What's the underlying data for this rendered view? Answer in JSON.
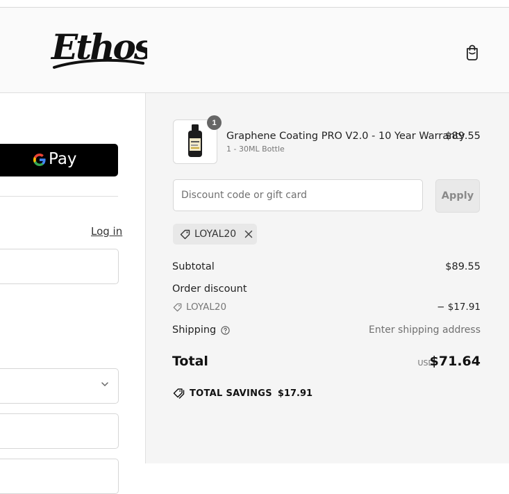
{
  "brand": {
    "logo_text": "Ethos"
  },
  "header": {
    "cart_icon": "shopping-bag-icon"
  },
  "express_checkout": {
    "gpay_label": "Pay",
    "gpay_g": "G"
  },
  "contact": {
    "login_label": "Log in"
  },
  "cart": {
    "items": [
      {
        "name": "Graphene Coating PRO V2.0 - 10 Year Warranty",
        "variant": "1 - 30ML Bottle",
        "price": "$89.55",
        "quantity": "1"
      }
    ]
  },
  "discount": {
    "placeholder": "Discount code or gift card",
    "apply_label": "Apply",
    "applied_code": "LOYAL20"
  },
  "summary": {
    "subtotal_label": "Subtotal",
    "subtotal_value": "$89.55",
    "order_discount_label": "Order discount",
    "discount_code": "LOYAL20",
    "discount_value": "− $17.91",
    "shipping_label": "Shipping",
    "shipping_value": "Enter shipping address",
    "total_label": "Total",
    "currency": "USD",
    "total_value": "$71.64",
    "savings_label": "TOTAL SAVINGS",
    "savings_value": "$17.91"
  },
  "colors": {
    "summary_bg": "#f5f5f5",
    "header_bg": "#fafafa",
    "gpay_bg": "#000000",
    "text": "#1f1f1f",
    "muted": "#707070"
  }
}
